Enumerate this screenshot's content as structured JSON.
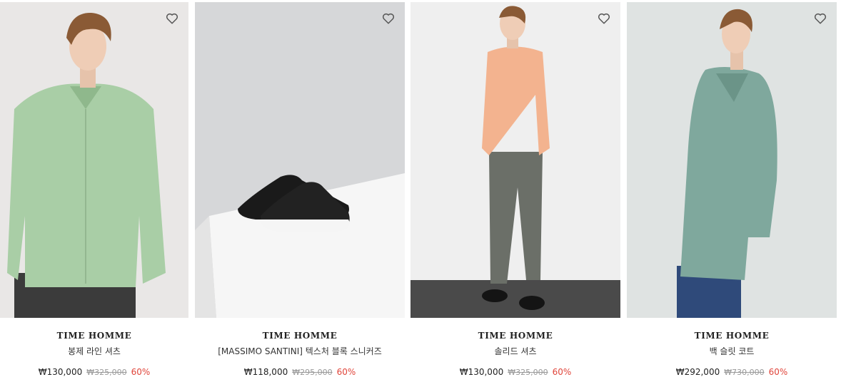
{
  "products": [
    {
      "brand": "TIME HOMME",
      "name": "봉제 라인 셔츠",
      "sale_price": "₩130,000",
      "original_price": "₩325,000",
      "discount": "60%",
      "icon": "heart-icon",
      "colors": {
        "bg": "#e9e7e6",
        "shirt": "#a9cea6"
      }
    },
    {
      "brand": "TIME HOMME",
      "name": "[MASSIMO SANTINI] 텍스처 블록 스니커즈",
      "sale_price": "₩118,000",
      "original_price": "₩295,000",
      "discount": "60%",
      "icon": "heart-icon",
      "colors": {
        "bg": "#d6d7d9",
        "shoe": "#1a1a1a"
      }
    },
    {
      "brand": "TIME HOMME",
      "name": "솔리드 셔츠",
      "sale_price": "₩130,000",
      "original_price": "₩325,000",
      "discount": "60%",
      "icon": "heart-icon",
      "colors": {
        "bg": "#efefef",
        "shirt": "#f3b38f",
        "pants": "#6b6f68"
      }
    },
    {
      "brand": "TIME HOMME",
      "name": "백 슬릿 코트",
      "sale_price": "₩292,000",
      "original_price": "₩730,000",
      "discount": "60%",
      "icon": "heart-icon",
      "colors": {
        "bg": "#dfe3e2",
        "coat": "#7fa89d"
      }
    }
  ],
  "colors": {
    "discount": "#e0453a",
    "strike": "#999999"
  }
}
